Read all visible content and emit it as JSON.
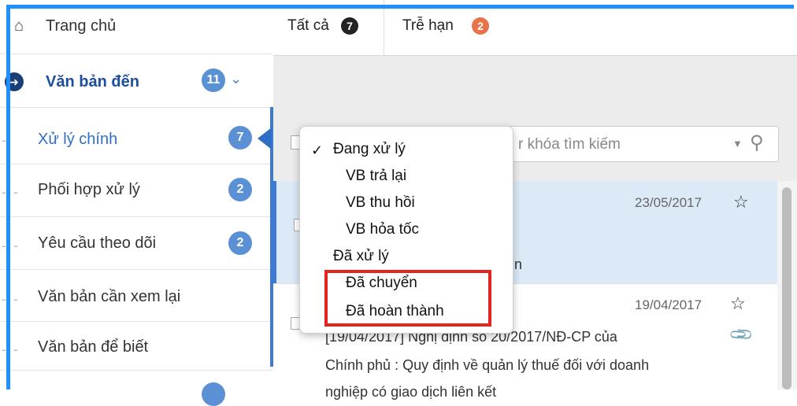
{
  "sidebar": {
    "home_label": "Trang chủ",
    "incoming_label": "Văn bản đến",
    "incoming_count": "11",
    "items": [
      {
        "label": "Xử lý chính",
        "count": "7"
      },
      {
        "label": "Phối hợp xử lý",
        "count": "2"
      },
      {
        "label": "Yêu cầu theo dõi",
        "count": "2"
      },
      {
        "label": "Văn bản cần xem lại",
        "count": ""
      },
      {
        "label": "Văn bản để biết",
        "count": ""
      }
    ]
  },
  "tabs": [
    {
      "label": "Tất cả",
      "count": "7",
      "badge_color": "#222222"
    },
    {
      "label": "Trễ hạn",
      "count": "2",
      "badge_color": "#e8734a"
    }
  ],
  "search": {
    "placeholder": "r khóa tìm kiếm"
  },
  "dropdown": {
    "items": [
      {
        "label": "Đang xử lý",
        "checked": true
      },
      {
        "label": "VB trả lại"
      },
      {
        "label": "VB thu hồi"
      },
      {
        "label": "VB hỏa tốc"
      },
      {
        "label": "Đã xử lý"
      },
      {
        "label": "Đã chuyển"
      },
      {
        "label": "Đã hoàn thành"
      }
    ]
  },
  "messages": [
    {
      "date": "23/05/2017",
      "partial": "n"
    },
    {
      "date": "19/04/2017",
      "line1": "[19/04/2017] Nghị định số 20/2017/NĐ-CP của",
      "line2": "Chính phủ : Quy định về quản lý thuế đối với doanh",
      "line3": "nghiệp có giao dịch liên kết"
    }
  ],
  "colors": {
    "accent": "#3d7ad1",
    "badge": "#5b91d4",
    "highlight": "#e3241f",
    "frame": "#1e90ff"
  }
}
